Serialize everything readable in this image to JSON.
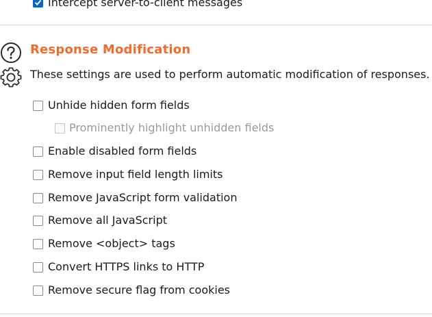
{
  "top": {
    "intercept_label": "Intercept server-to-client messages",
    "intercept_checked": true
  },
  "section": {
    "title": "Response Modification",
    "description": "These settings are used to perform automatic modification of responses.",
    "help_icon": "help-icon",
    "settings_icon": "gear-icon"
  },
  "options": [
    {
      "label": "Unhide hidden form fields",
      "checked": false,
      "enabled": true
    },
    {
      "label": "Prominently highlight unhidden fields",
      "checked": false,
      "enabled": false
    },
    {
      "label": "Enable disabled form fields",
      "checked": false,
      "enabled": true
    },
    {
      "label": "Remove input field length limits",
      "checked": false,
      "enabled": true
    },
    {
      "label": "Remove JavaScript form validation",
      "checked": false,
      "enabled": true
    },
    {
      "label": "Remove all JavaScript",
      "checked": false,
      "enabled": true
    },
    {
      "label": "Remove <object> tags",
      "checked": false,
      "enabled": true
    },
    {
      "label": "Convert HTTPS links to HTTP",
      "checked": false,
      "enabled": true
    },
    {
      "label": "Remove secure flag from cookies",
      "checked": false,
      "enabled": true
    }
  ],
  "colors": {
    "accent": "#f26b2b",
    "checkbox_checked": "#0a66c2",
    "disabled_text": "#9a9a9a"
  }
}
